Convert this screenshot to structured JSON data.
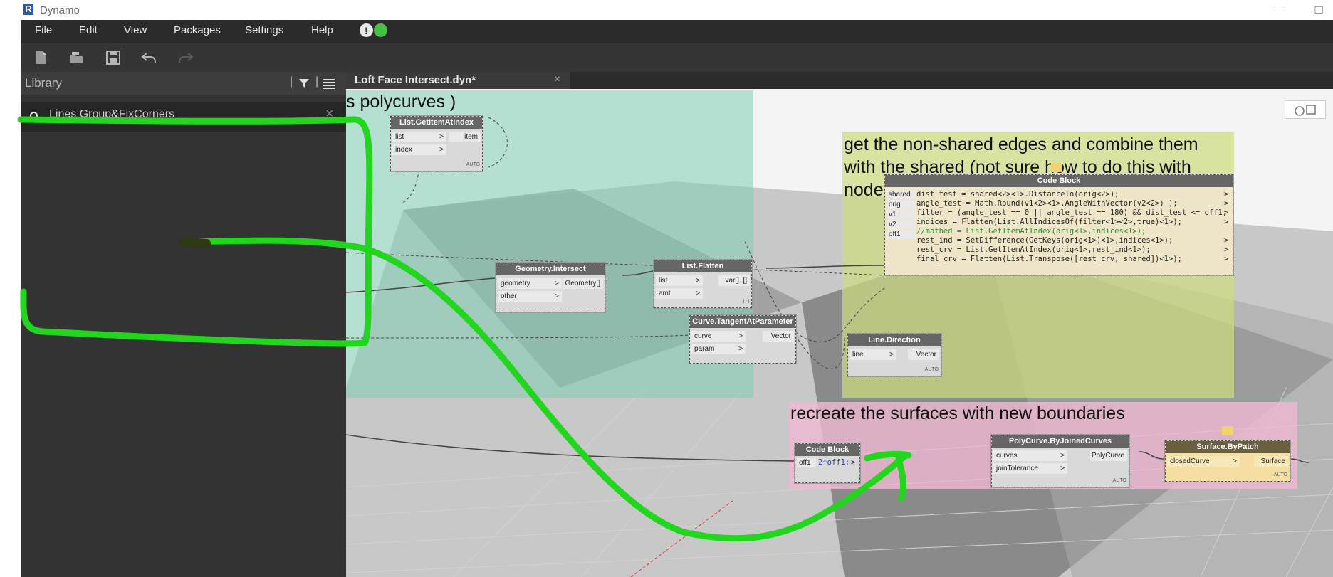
{
  "window": {
    "title": "Dynamo",
    "logo_letter": "R"
  },
  "menu": {
    "items": [
      "File",
      "Edit",
      "View",
      "Packages",
      "Settings",
      "Help"
    ]
  },
  "status": {
    "colors": {
      "warning": "#e8e8e8",
      "ok": "#46c046"
    }
  },
  "toolbar": {
    "icons": [
      "new-file-icon",
      "open-file-icon",
      "save-icon",
      "undo-icon",
      "redo-icon"
    ]
  },
  "library": {
    "title": "Library",
    "search_value": "Lines.Group&FixCorners",
    "search_clear": "×"
  },
  "tab": {
    "label": "Loft Face Intersect.dyn*",
    "close": "×"
  },
  "groups": {
    "teal": {
      "title": "s polycurves )",
      "color": "#9fd4c3"
    },
    "green": {
      "title": "get the non-shared edges and combine them with the shared (not sure how to do this with nodes)",
      "color": "#d5df9d"
    },
    "pink": {
      "title": "recreate the surfaces with new boundaries",
      "color": "#f2c3d4"
    }
  },
  "nodes": {
    "get_item": {
      "name": "List.GetItemAtIndex",
      "inputs": [
        "list",
        "index"
      ],
      "outputs": [
        "item"
      ],
      "auto": "AUTO"
    },
    "geo_intersect": {
      "name": "Geometry.Intersect",
      "inputs": [
        "geometry",
        "other"
      ],
      "outputs": [
        "Geometry[]"
      ]
    },
    "flatten": {
      "name": "List.Flatten",
      "inputs": [
        "list",
        "amt"
      ],
      "outputs": [
        "var[]..[]"
      ],
      "lacing": "l l l"
    },
    "tangent": {
      "name": "Curve.TangentAtParameter",
      "inputs": [
        "curve",
        "param"
      ],
      "outputs": [
        "Vector"
      ]
    },
    "line_dir": {
      "name": "Line.Direction",
      "inputs": [
        "line"
      ],
      "outputs": [
        "Vector"
      ],
      "auto": "AUTO"
    },
    "code_main": {
      "name": "Code Block",
      "inputs": [
        "shared",
        "orig",
        "v1",
        "v2",
        "off1"
      ],
      "lines": [
        "dist_test = shared<2><1>.DistanceTo(orig<2>);",
        "angle_test = Math.Round(v1<2><1>.AngleWithVector(v2<2>) );",
        "filter = (angle_test == 0 || angle_test == 180) && dist_test <= off1;",
        "indices = Flatten(List.AllIndicesOf(filter<1><2>,true)<1>);",
        "//mathed = List.GetItemAtIndex(orig<1>,indices<1>);",
        "rest_ind = SetDifference(GetKeys(orig<1>)<1>,indices<1>);",
        "rest_crv = List.GetItemAtIndex(orig<1>,rest_ind<1>);",
        "final_crv = Flatten(List.Transpose([rest_crv, shared])<1>);"
      ],
      "out_marker": ">"
    },
    "code_small": {
      "name": "Code Block",
      "input": "off1",
      "code": "2*off1;",
      "out_marker": ">"
    },
    "polycurve": {
      "name": "PolyCurve.ByJoinedCurves",
      "inputs": [
        "curves",
        "joinTolerance"
      ],
      "outputs": [
        "PolyCurve"
      ],
      "auto": "AUTO"
    },
    "surface": {
      "name": "Surface.ByPatch",
      "inputs": [
        "closedCurve"
      ],
      "outputs": [
        "Surface"
      ],
      "auto": "AUTO"
    }
  },
  "colors": {
    "annotation_green": "#22d61e",
    "library_bg": "#333333",
    "menubar_bg": "#2b2b2b"
  }
}
